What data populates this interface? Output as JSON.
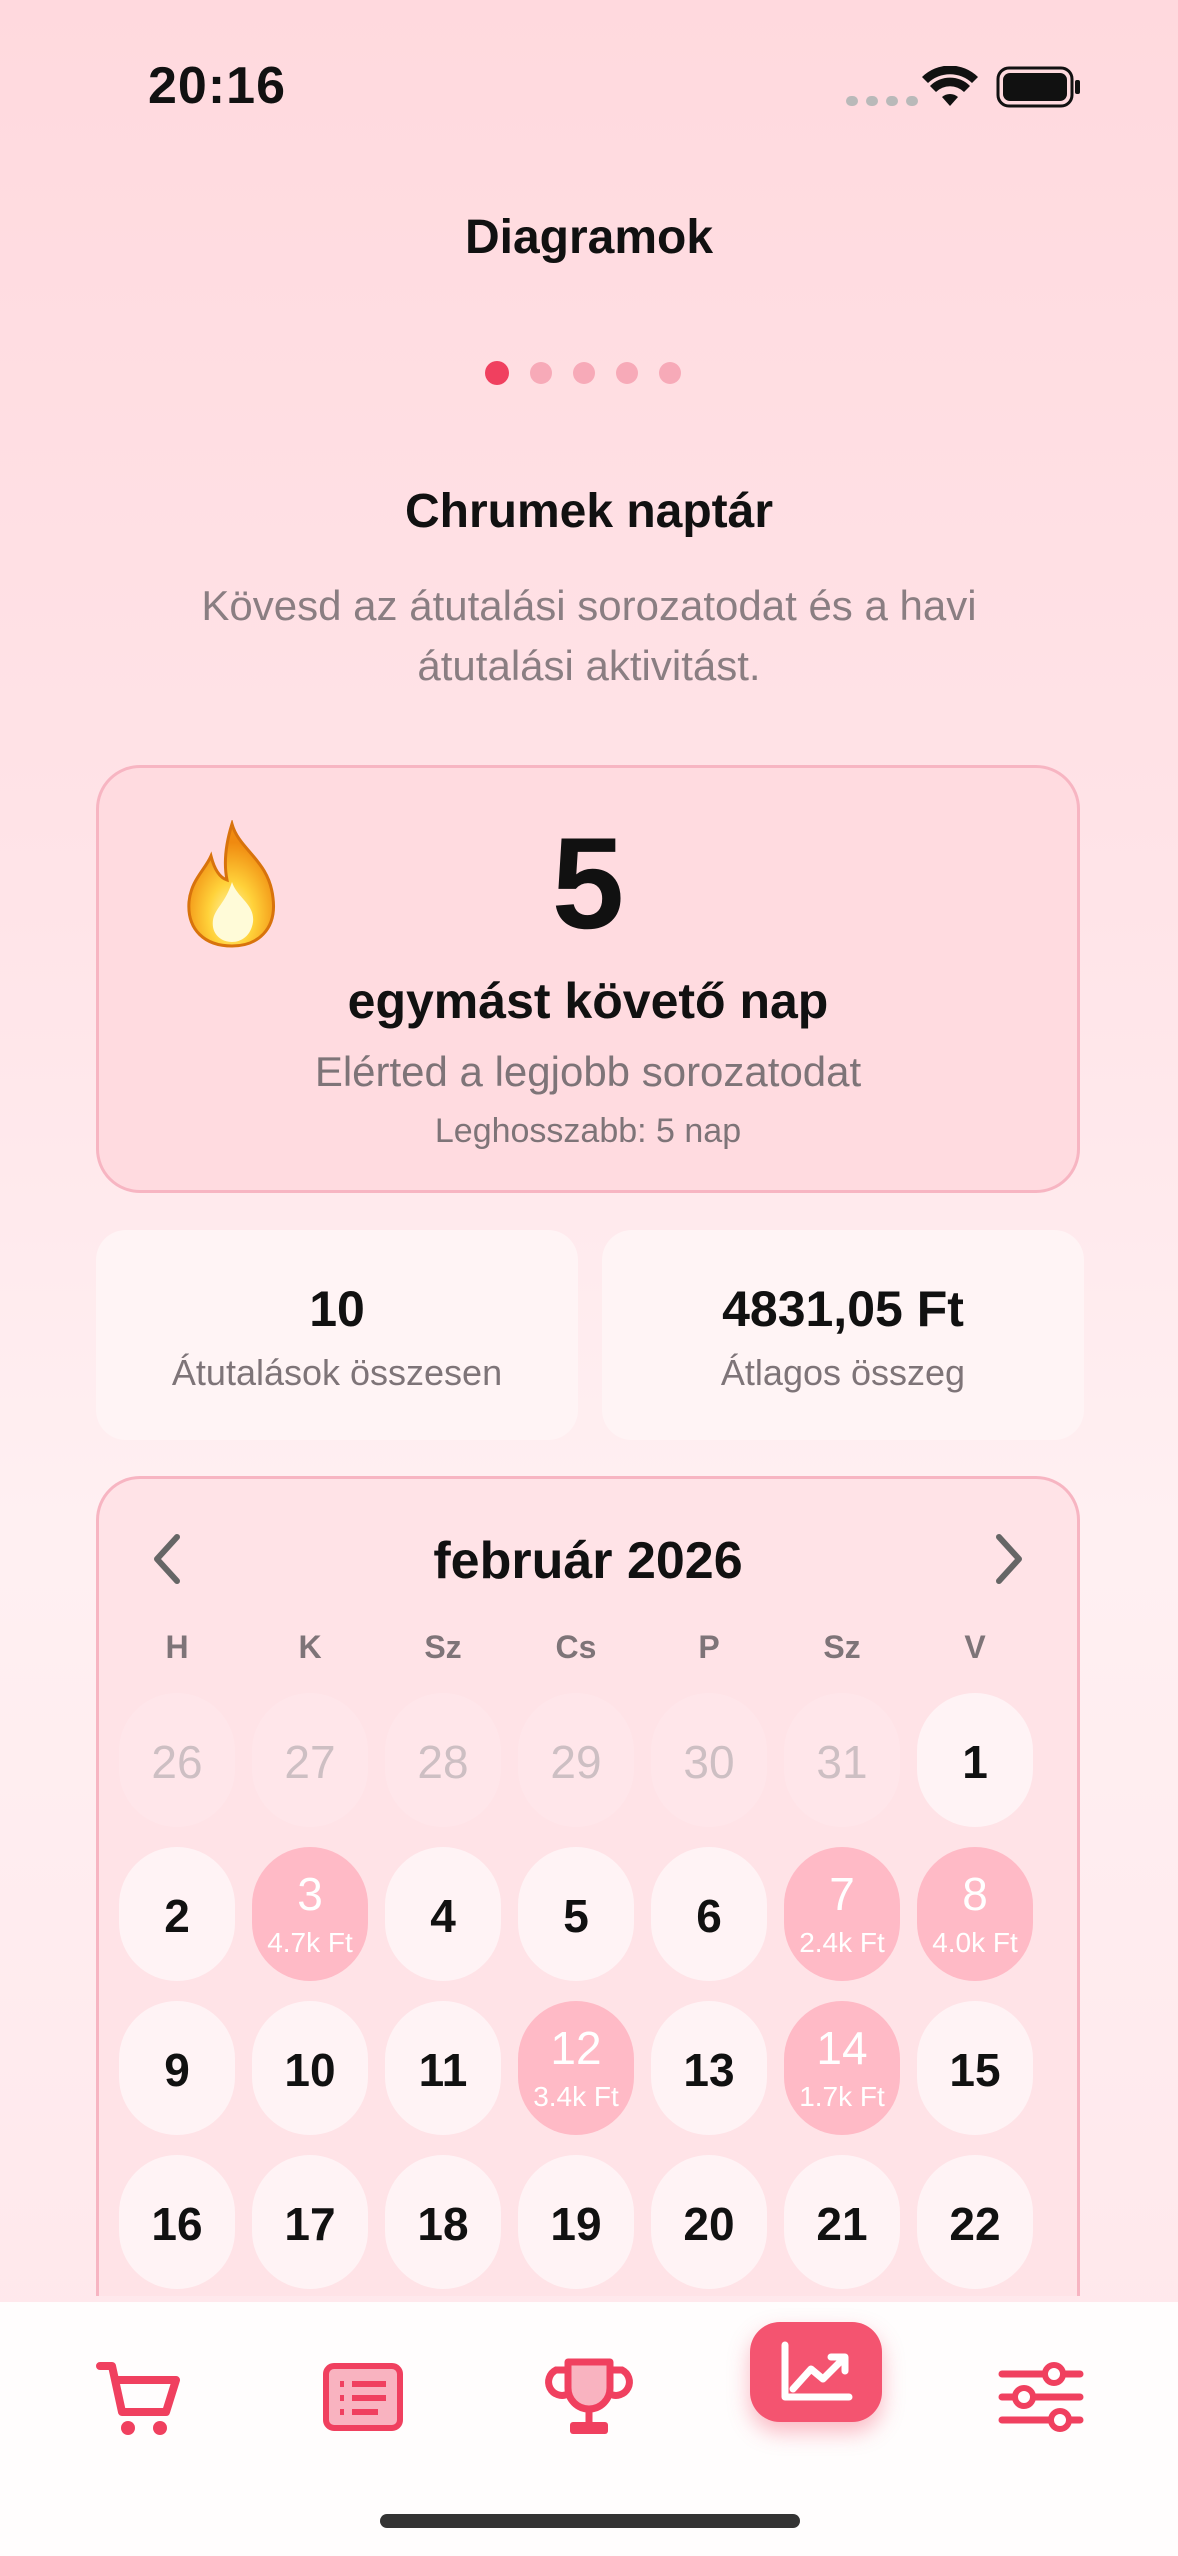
{
  "status_bar": {
    "time": "20:16"
  },
  "header": {
    "title": "Diagramok",
    "page_dots": 5,
    "active_dot": 1
  },
  "streak_section": {
    "title": "Chrumek naptár",
    "subtitle_line1": "Kövesd az átutalási sorozatodat és a havi",
    "subtitle_line2": "átutalási aktivitást."
  },
  "streak_card": {
    "icon": "flame-icon",
    "number": "5",
    "label": "egymást követő nap",
    "message": "Elérted a legjobb sorozatodat",
    "longest": "Leghosszabb: 5 nap"
  },
  "stats": {
    "total_value": "10",
    "total_label": "Átutalások összesen",
    "average_value": "4831,05 Ft",
    "average_label": "Átlagos összeg"
  },
  "calendar": {
    "month": "február 2026",
    "weekdays": [
      "H",
      "K",
      "Sz",
      "Cs",
      "P",
      "Sz",
      "V"
    ],
    "rows": [
      [
        {
          "d": "26",
          "muted": true
        },
        {
          "d": "27",
          "muted": true
        },
        {
          "d": "28",
          "muted": true
        },
        {
          "d": "29",
          "muted": true
        },
        {
          "d": "30",
          "muted": true
        },
        {
          "d": "31",
          "muted": true
        },
        {
          "d": "1"
        }
      ],
      [
        {
          "d": "2"
        },
        {
          "d": "3",
          "amt": "4.7k Ft"
        },
        {
          "d": "4"
        },
        {
          "d": "5"
        },
        {
          "d": "6"
        },
        {
          "d": "7",
          "amt": "2.4k Ft"
        },
        {
          "d": "8",
          "amt": "4.0k Ft"
        }
      ],
      [
        {
          "d": "9"
        },
        {
          "d": "10"
        },
        {
          "d": "11"
        },
        {
          "d": "12",
          "amt": "3.4k Ft"
        },
        {
          "d": "13"
        },
        {
          "d": "14",
          "amt": "1.7k Ft"
        },
        {
          "d": "15"
        }
      ],
      [
        {
          "d": "16"
        },
        {
          "d": "17"
        },
        {
          "d": "18"
        },
        {
          "d": "19"
        },
        {
          "d": "20"
        },
        {
          "d": "21"
        },
        {
          "d": "22"
        }
      ]
    ]
  },
  "tab_bar": {
    "items": [
      "cart-icon",
      "list-icon",
      "trophy-icon",
      "chart-icon",
      "sliders-icon"
    ],
    "active": "chart-icon",
    "accent": "#f0405f"
  }
}
